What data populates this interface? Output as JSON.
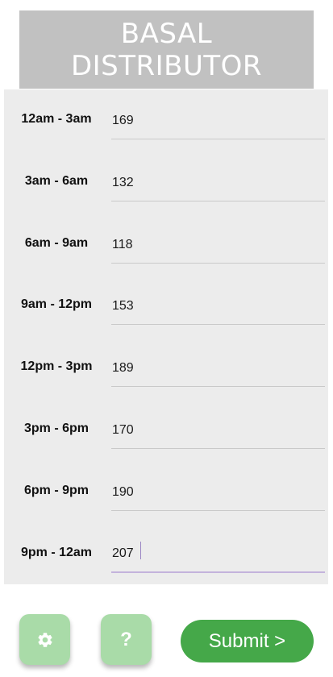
{
  "title": {
    "line1": "BASAL",
    "line2": "DISTRIBUTOR"
  },
  "rows": [
    {
      "label": "12am - 3am",
      "value": "169"
    },
    {
      "label": "3am - 6am",
      "value": "132"
    },
    {
      "label": "6am - 9am",
      "value": "118"
    },
    {
      "label": "9am - 12pm",
      "value": "153"
    },
    {
      "label": "12pm - 3pm",
      "value": "189"
    },
    {
      "label": "3pm - 6pm",
      "value": "170"
    },
    {
      "label": "6pm - 9pm",
      "value": "190"
    },
    {
      "label": "9pm - 12am",
      "value": "207"
    }
  ],
  "buttons": {
    "settings_icon": "gear-icon",
    "help_label": "?",
    "submit_label": "Submit >"
  },
  "colors": {
    "title_bg": "#c1c1c1",
    "panel_bg": "#ececec",
    "button_light_green": "#a9dba8",
    "button_green": "#45a849",
    "active_underline": "#c4b3dc"
  }
}
